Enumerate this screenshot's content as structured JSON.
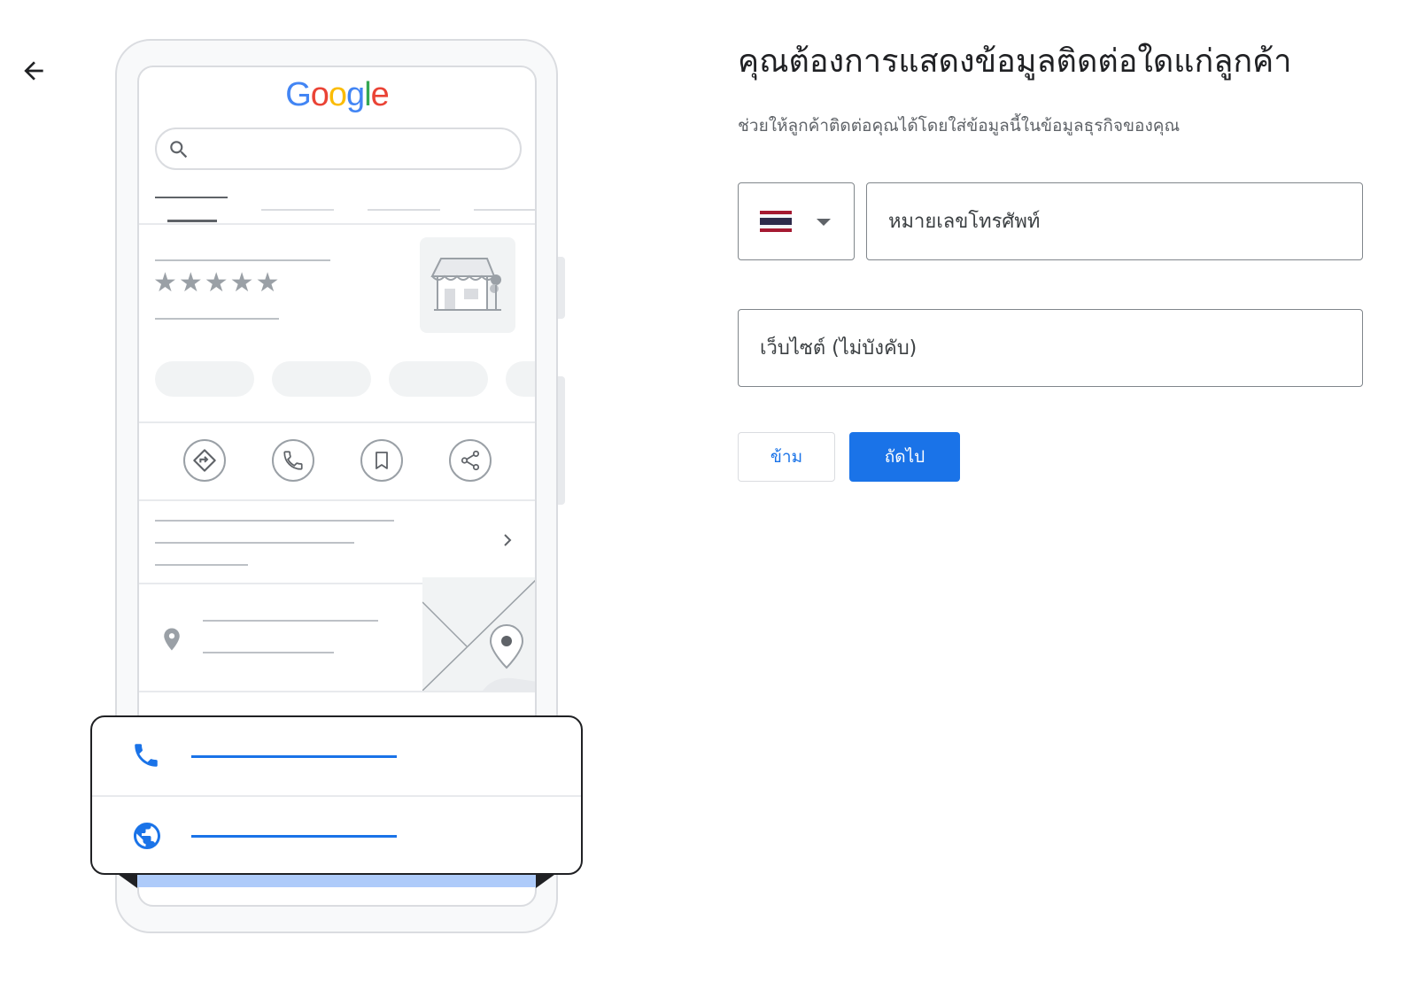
{
  "page": {
    "title": "คุณต้องการแสดงข้อมูลติดต่อใดแก่ลูกค้า",
    "subtitle": "ช่วยให้ลูกค้าติดต่อคุณได้โดยใส่ข้อมูลนี้ในข้อมูลธุรกิจของคุณ"
  },
  "nav": {
    "back_icon": "arrow-back-icon"
  },
  "illustration": {
    "logo": [
      "G",
      "o",
      "o",
      "g",
      "l",
      "e"
    ],
    "logo_colors": [
      "#4285F4",
      "#EA4335",
      "#FBBC05",
      "#4285F4",
      "#34A853",
      "#EA4335"
    ],
    "stars": "★★★★★",
    "icons": [
      "search-icon",
      "directions-icon",
      "phone-icon",
      "bookmark-icon",
      "share-icon",
      "chevron-right-icon",
      "location-pin-icon",
      "globe-icon"
    ]
  },
  "form": {
    "country": {
      "selected": "Thailand",
      "flag_icon": "thailand-flag-icon"
    },
    "phone_placeholder": "หมายเลขโทรศัพท์",
    "website_placeholder": "เว็บไซต์ (ไม่บังคับ)",
    "skip_label": "ข้าม",
    "next_label": "ถัดไป"
  },
  "colors": {
    "accent": "#1a73e8",
    "border": "#80868b",
    "muted": "#5f6368"
  }
}
